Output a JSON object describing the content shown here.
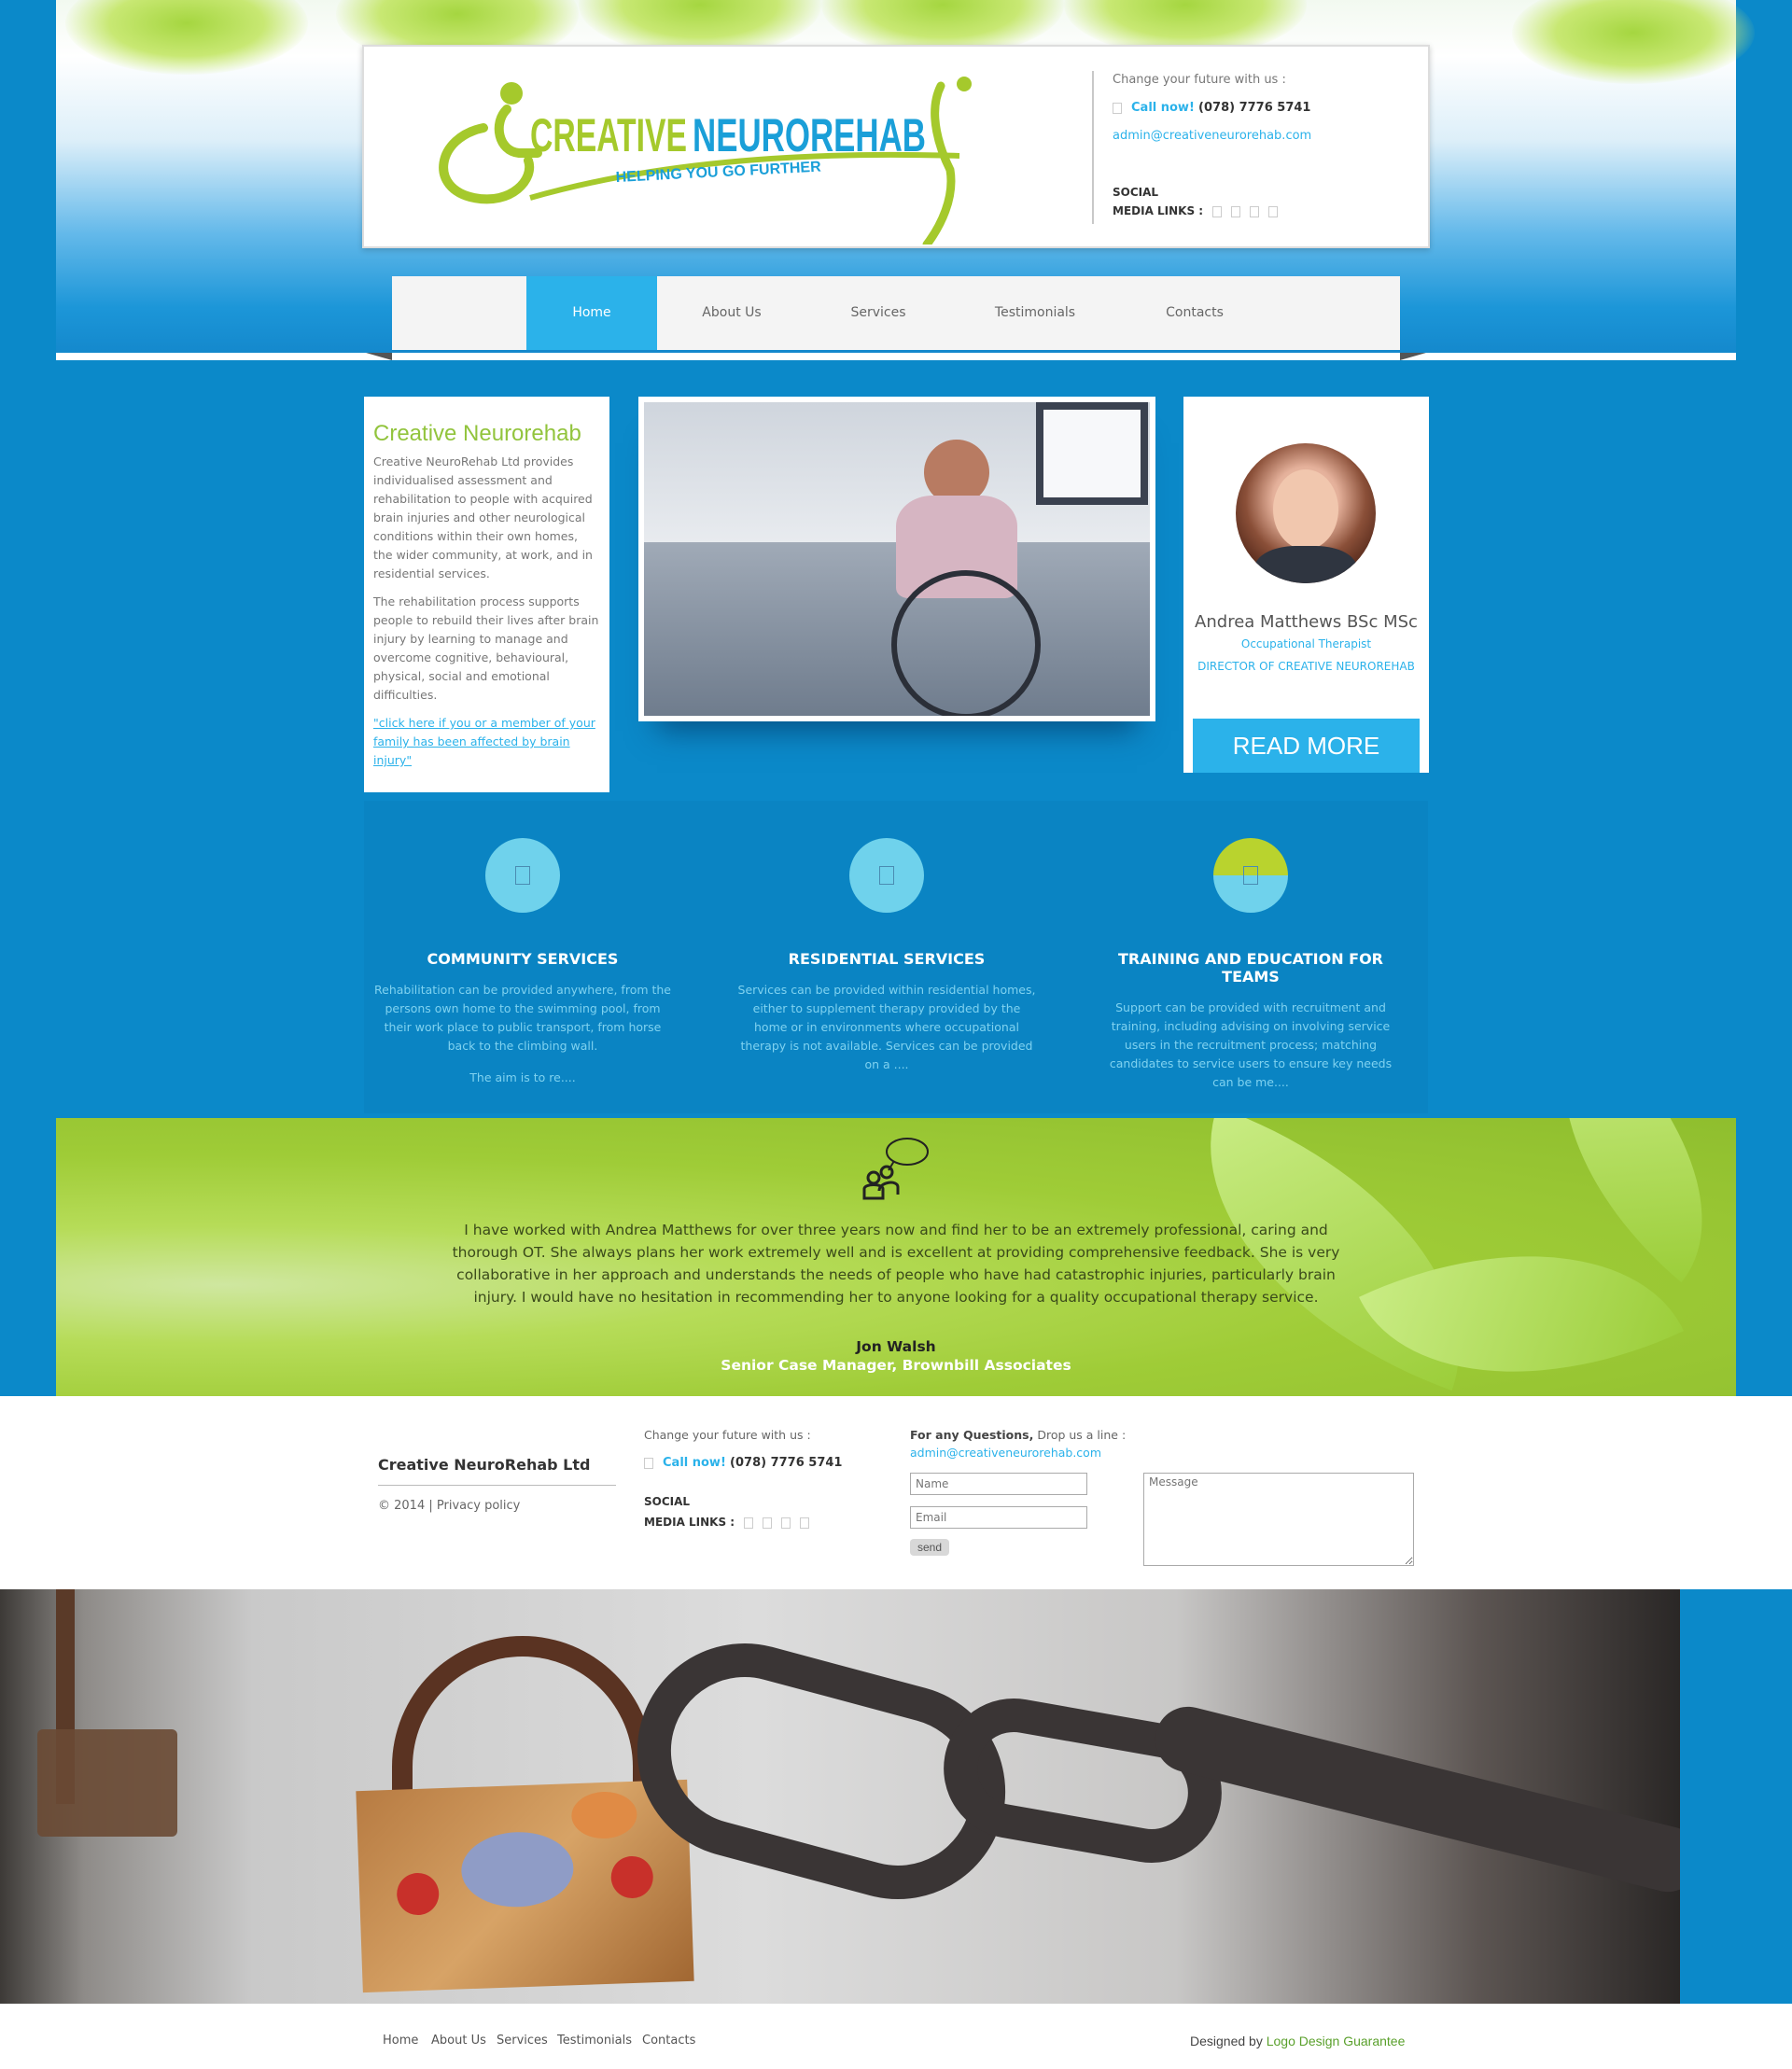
{
  "header": {
    "logo": {
      "word1": "CREATIVE",
      "word2": "NEUROREHAB",
      "tagline": "HELPING YOU GO FURTHER"
    },
    "contact": {
      "intro": "Change your future with us :",
      "call_label": "Call now!",
      "phone": "(078) 7776 5741",
      "email": "admin@creativeneurorehab.com",
      "social_line1": "SOCIAL",
      "social_line2": "MEDIA LINKS :"
    }
  },
  "nav": {
    "items": [
      {
        "label": "Home"
      },
      {
        "label": "About Us"
      },
      {
        "label": "Services"
      },
      {
        "label": "Testimonials"
      },
      {
        "label": "Contacts"
      }
    ],
    "active": "Home"
  },
  "intro": {
    "title": "Creative Neurorehab",
    "p1": "Creative NeuroRehab Ltd provides individualised assessment and rehabilitation to people with acquired brain injuries and other neurological conditions within their own homes, the wider community, at work, and in residential services.",
    "p2": "The rehabilitation process supports people to rebuild their lives after brain injury by learning to manage and overcome cognitive, behavioural, physical, social and emotional difficulties.",
    "link": "\"click here if you or a member of your family has been affected by brain injury\""
  },
  "profile": {
    "name": "Andrea Matthews BSc MSc",
    "role": "Occupational Therapist",
    "title": "DIRECTOR OF CREATIVE NEUROREHAB",
    "button": "READ MORE"
  },
  "services": [
    {
      "title": "COMMUNITY SERVICES",
      "text": "Rehabilitation can be provided anywhere, from the persons own home to the swimming pool, from their work place to public transport, from horse back to the climbing wall.",
      "more": "The aim is to re....",
      "icon": "community-icon"
    },
    {
      "title": "RESIDENTIAL SERVICES",
      "text": "Services can be provided within residential homes, either to supplement therapy provided by the home or in environments where occupational therapy is not available. Services can be provided on a ....",
      "more": "",
      "icon": "residential-icon"
    },
    {
      "title": "TRAINING AND EDUCATION FOR TEAMS",
      "text": "Support can be provided with recruitment and training, including advising on involving service users in the recruitment process; matching candidates to service users to ensure key needs can be me....",
      "more": "",
      "icon": "training-icon"
    }
  ],
  "testimonial": {
    "quote": "I have worked with Andrea Matthews for over three years now and find her to be an extremely professional, caring and thorough OT. She always plans her work extremely well and is excellent at providing comprehensive feedback. She is very collaborative in her approach and understands the needs of people who have had catastrophic injuries, particularly brain injury. I would have no hesitation in recommending her to anyone looking for a quality occupational therapy service.",
    "author": "Jon Walsh",
    "role": "Senior Case Manager, Brownbill Associates"
  },
  "footer": {
    "company": "Creative NeuroRehab Ltd",
    "copyright": "© 2014",
    "separator": "|",
    "privacy": "Privacy policy",
    "contact_intro": "Change your future with us :",
    "call_label": "Call now!",
    "phone": "(078) 7776 5741",
    "social_line1": "SOCIAL",
    "social_line2": "MEDIA LINKS :",
    "form_heading_bold": "For any Questions,",
    "form_heading": "Drop us a line :",
    "form_email": "admin@creativeneurorehab.com",
    "name_placeholder": "Name",
    "email_placeholder": "Email",
    "message_placeholder": "Message",
    "send": "send"
  },
  "bottom": {
    "links": [
      "Home",
      "About Us",
      "Services",
      "Testimonials",
      "Contacts"
    ],
    "designed_by": "Designed by",
    "designer": "Logo Design Guarantee"
  },
  "colors": {
    "accent": "#2bb2ea",
    "brand_green": "#92c43d",
    "background": "#0b89c9"
  }
}
